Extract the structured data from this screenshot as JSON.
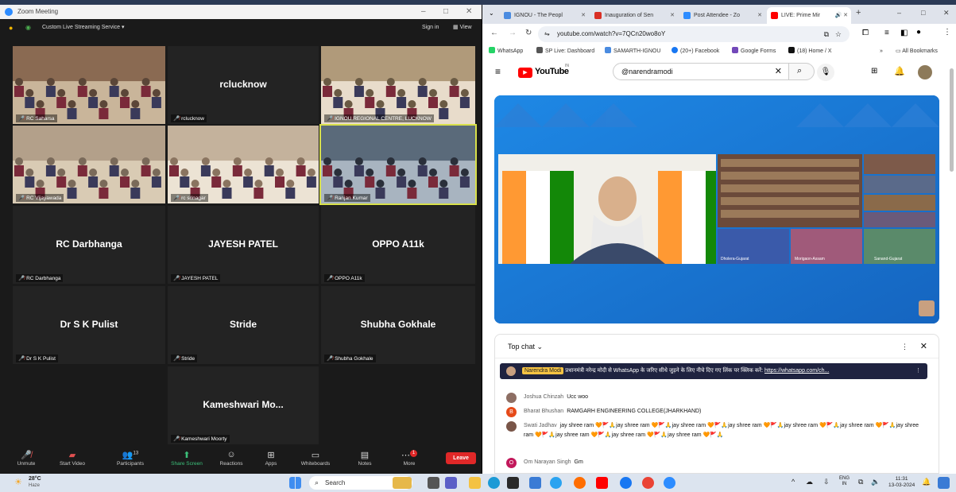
{
  "zoom": {
    "title": "Zoom Meeting",
    "live_streaming": "Custom Live Streaming Service",
    "sign_in": "Sign in",
    "view": "View",
    "tiles": [
      {
        "name": "RC Saharsa",
        "display": "",
        "video": true
      },
      {
        "name": "rclucknow",
        "display": "rclucknow",
        "video": false
      },
      {
        "name": "IGNOU REGIONAL CENTRE, LUCKNOW",
        "display": "",
        "video": true
      },
      {
        "name": "RC Vijayawada",
        "display": "",
        "video": true
      },
      {
        "name": "rc srinagar",
        "display": "",
        "video": true
      },
      {
        "name": "Ranjan Kumar",
        "display": "",
        "video": true
      },
      {
        "name": "RC Darbhanga",
        "display": "RC Darbhanga",
        "video": false
      },
      {
        "name": "JAYESH PATEL",
        "display": "JAYESH PATEL",
        "video": false
      },
      {
        "name": "OPPO A11k",
        "display": "OPPO A11k",
        "video": false
      },
      {
        "name": "Dr S K Pulist",
        "display": "Dr S K Pulist",
        "video": false
      },
      {
        "name": "Stride",
        "display": "Stride",
        "video": false
      },
      {
        "name": "Shubha Gokhale",
        "display": "Shubha Gokhale",
        "video": false
      },
      {
        "name": "Kameshwari Moorty",
        "display": "Kameshwari Mo...",
        "video": false
      }
    ],
    "toolbar": {
      "unmute": "Unmute",
      "start_video": "Start Video",
      "participants": "Participants",
      "participants_count": "13",
      "share_screen": "Share Screen",
      "reactions": "Reactions",
      "apps": "Apps",
      "whiteboards": "Whiteboards",
      "notes": "Notes",
      "more": "More",
      "more_badge": "1",
      "leave": "Leave"
    }
  },
  "browser": {
    "tabs": [
      {
        "label": "IGNOU - The Peopl",
        "color": "#4a8be0"
      },
      {
        "label": "Inauguration of Sen",
        "color": "#d93025"
      },
      {
        "label": "Post Attendee - Zo",
        "color": "#2d8cff"
      },
      {
        "label": "LIVE: Prime Mir",
        "color": "#ff0000"
      }
    ],
    "url": "youtube.com/watch?v=7QCn20wo8oY",
    "bookmarks": [
      {
        "label": "WhatsApp",
        "color": "#25d366"
      },
      {
        "label": "SP Live: Dashboard",
        "color": "#555555"
      },
      {
        "label": "SAMARTH-IGNOU",
        "color": "#4a8be0"
      },
      {
        "label": "(20+) Facebook",
        "color": "#1877f2"
      },
      {
        "label": "Google Forms",
        "color": "#7248b9"
      },
      {
        "label": "(18) Home / X",
        "color": "#111111"
      }
    ],
    "all_bookmarks": "All Bookmarks",
    "youtube": {
      "logo": "YouTube",
      "logo_sup": "IN",
      "search": "@narendramodi",
      "video_captions": [
        "Dholera-Gujarat",
        "Morigaon-Assam",
        "Sanand-Gujarat"
      ],
      "chat_title": "Top chat",
      "pinned_author": "Narendra Modi",
      "pinned_text": "प्रधानमंत्री नरेन्द्र मोदी से WhatsApp के जरिए सीधे जुड़ने के लिए नीचे दिए गए लिंक पर क्लिक करें:",
      "pinned_link": "https://whatsapp.com/ch...",
      "messages": [
        {
          "author": "Joshua Chinzah",
          "text": "Ucc woo",
          "initial": "",
          "color": "#8d6e63"
        },
        {
          "author": "Bharat Bhushan",
          "text": "RAMGARH ENGINEERING COLLEGE(JHARKHAND)",
          "initial": "B",
          "color": "#e64a19"
        },
        {
          "author": "Swati Jadhav",
          "text": "jay shree ram 🧡🚩🙏jay shree ram 🧡🚩🙏jay shree ram 🧡🚩🙏jay shree ram 🧡🚩🙏jay shree ram 🧡🚩🙏jay shree ram 🧡🚩🙏jay shree ram 🧡🚩🙏jay shree ram 🧡🚩🙏jay shree ram 🧡🚩🙏jay shree ram 🧡🚩🙏",
          "initial": "",
          "color": "#795548"
        },
        {
          "author": "Om Narayan Singh",
          "text": "Gm",
          "initial": "O",
          "color": "#c2185b"
        }
      ]
    }
  },
  "taskbar": {
    "temp": "28°C",
    "weather": "Haze",
    "search": "Search",
    "lang": "ENG",
    "region": "IN",
    "time": "11:31",
    "date": "13-03-2024"
  }
}
